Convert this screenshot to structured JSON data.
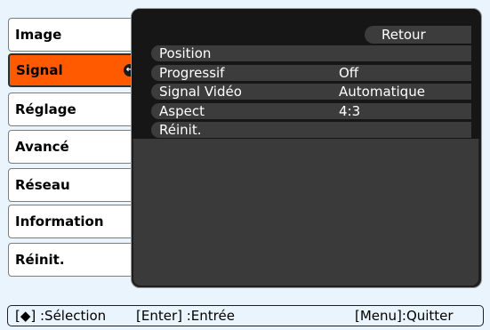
{
  "tabs": [
    {
      "label": "Image",
      "selected": false
    },
    {
      "label": "Signal",
      "selected": true
    },
    {
      "label": "Réglage",
      "selected": false
    },
    {
      "label": "Avancé",
      "selected": false
    },
    {
      "label": "Réseau",
      "selected": false
    },
    {
      "label": "Information",
      "selected": false
    },
    {
      "label": "Réinit.",
      "selected": false
    }
  ],
  "panel": {
    "return_label": "Retour",
    "items": [
      {
        "label": "Position",
        "value": ""
      },
      {
        "label": "Progressif",
        "value": "Off"
      },
      {
        "label": "Signal Vidéo",
        "value": "Automatique"
      },
      {
        "label": "Aspect",
        "value": "4:3"
      },
      {
        "label": "Réinit.",
        "value": ""
      }
    ]
  },
  "help": {
    "select": "[◆] :Sélection",
    "enter": "[Enter] :Entrée",
    "quit": "[Menu]:Quitter"
  },
  "colors": {
    "background": "#e9f4fc",
    "selected_tab": "#ff5a00",
    "panel": "#1f1f1f",
    "row": "#3c3c3c"
  }
}
